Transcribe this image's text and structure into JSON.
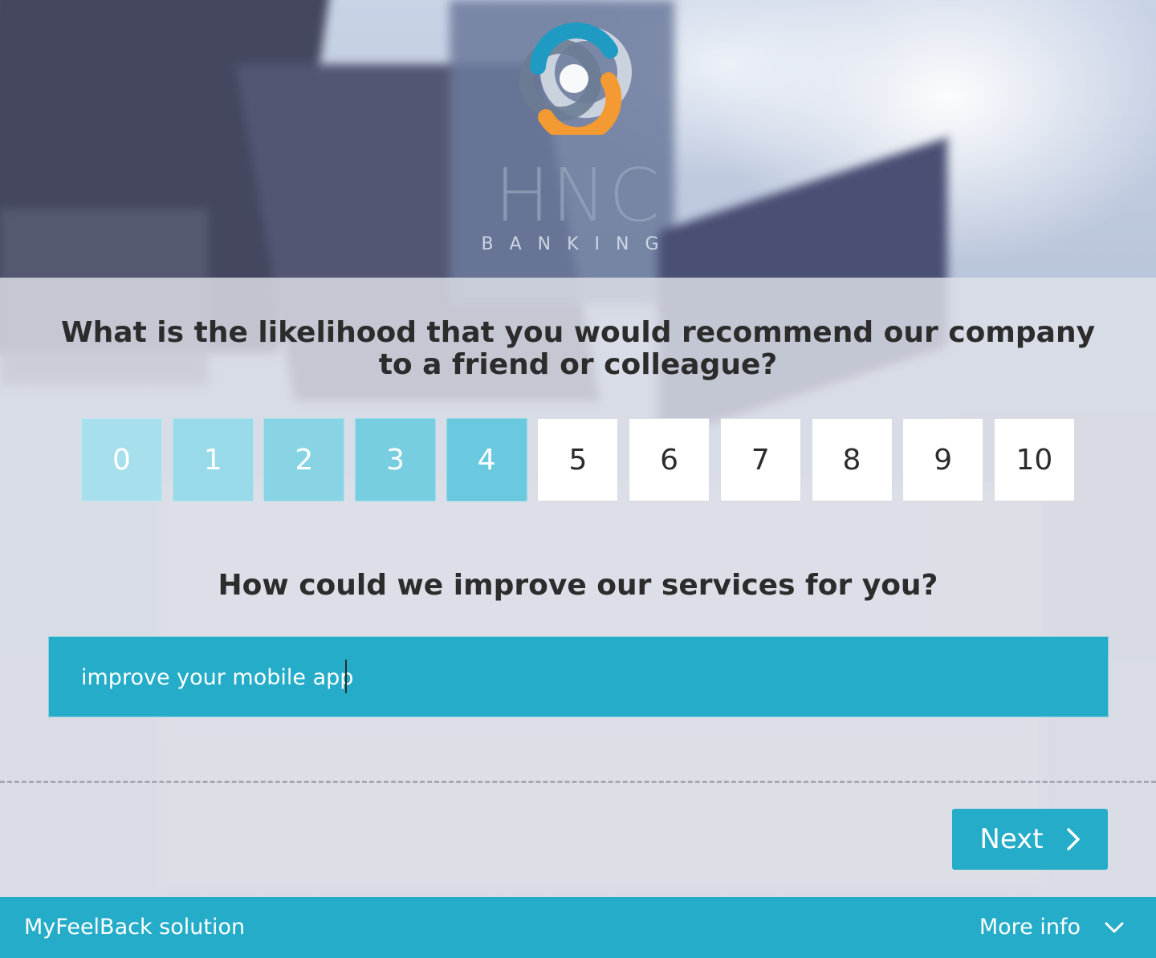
{
  "brand": {
    "logo_text": "HNC",
    "logo_subtext": "BANKING",
    "colors": {
      "blue": "#1f9ac2",
      "gray": "#6c7c93",
      "orange": "#f39a32",
      "light": "#cfd6df"
    }
  },
  "survey": {
    "question_nps": "What is the likelihood that you would recommend our company to a friend or colleague?",
    "scale": [
      {
        "label": "0",
        "selected": true,
        "color": "#a7e0ec"
      },
      {
        "label": "1",
        "selected": true,
        "color": "#98dae9"
      },
      {
        "label": "2",
        "selected": true,
        "color": "#88d4e5"
      },
      {
        "label": "3",
        "selected": true,
        "color": "#78cee1"
      },
      {
        "label": "4",
        "selected": true,
        "color": "#6ac9de"
      },
      {
        "label": "5",
        "selected": false
      },
      {
        "label": "6",
        "selected": false
      },
      {
        "label": "7",
        "selected": false
      },
      {
        "label": "8",
        "selected": false
      },
      {
        "label": "9",
        "selected": false
      },
      {
        "label": "10",
        "selected": false
      }
    ],
    "question_open": "How could we improve our services for you?",
    "answer_value": "improve your mobile app",
    "next_label": "Next"
  },
  "footer": {
    "brand_label": "MyFeelBack solution",
    "more_label": "More info"
  },
  "theme": {
    "accent": "#24acc9",
    "text": "#2c2c2c"
  }
}
